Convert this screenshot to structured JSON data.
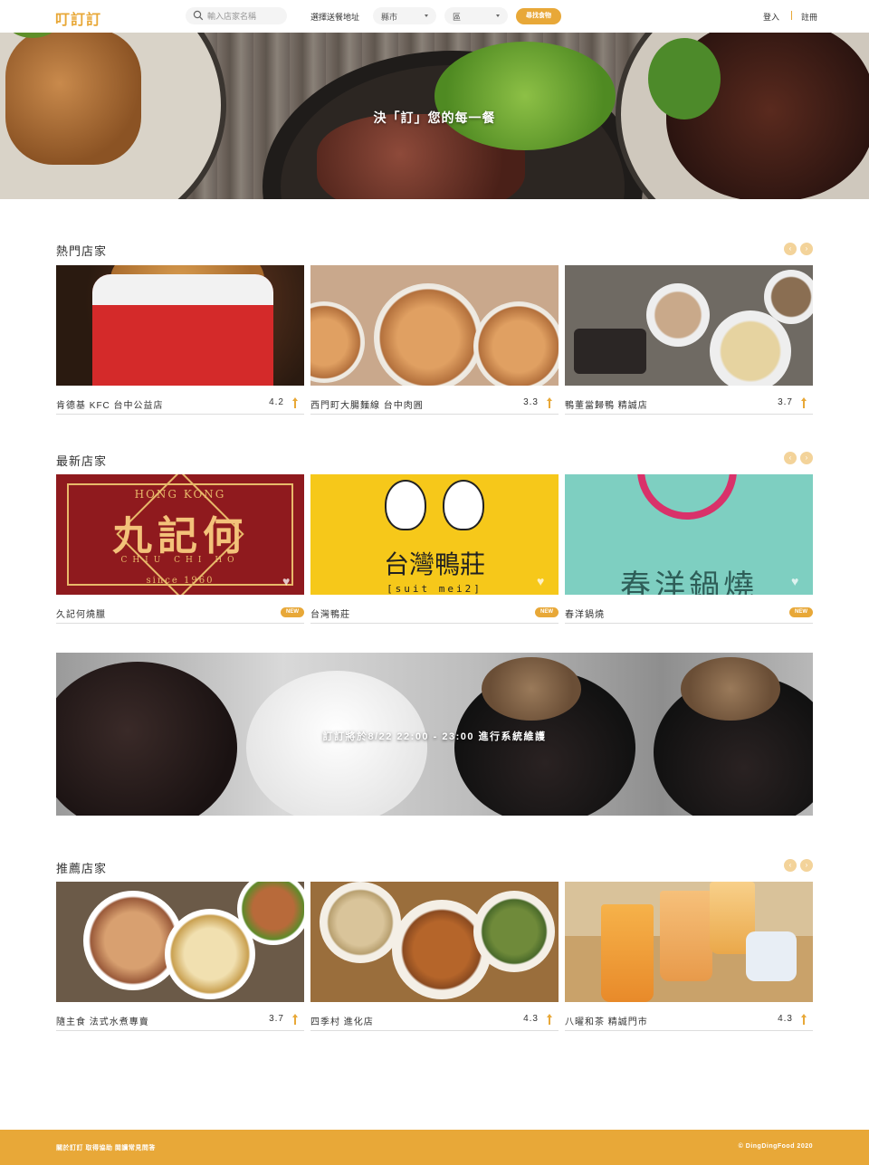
{
  "header": {
    "logo": "叮訂訂",
    "search_placeholder": "輸入店家名稱",
    "address_label": "選擇送餐地址",
    "city_select": "縣市",
    "district_select": "區",
    "find_button": "尋找食物",
    "login": "登入",
    "register": "註冊"
  },
  "hero": {
    "slogan": "決「訂」您的每一餐"
  },
  "sections": {
    "popular": {
      "title": "熱門店家",
      "items": [
        {
          "name": "肯德基 KFC 台中公益店",
          "rating": "4.2"
        },
        {
          "name": "西門町大腸麵線 台中肉圓",
          "rating": "3.3"
        },
        {
          "name": "鴨董當歸鴨 精誠店",
          "rating": "3.7"
        }
      ]
    },
    "newest": {
      "title": "最新店家",
      "badge": "NEW",
      "items": [
        {
          "name": "久記何燒臘",
          "logo_l1": "HONG KONG",
          "logo_l2": "九記何",
          "logo_l3": "CHIU  CHI  HO",
          "logo_l4": "since 1960"
        },
        {
          "name": "台灣鴨莊",
          "logo_l1": "台灣鴨莊",
          "logo_l2": "[suit mei2]"
        },
        {
          "name": "春洋鍋燒",
          "logo_l1": "春洋鍋燒"
        }
      ]
    },
    "banner": {
      "text": "訂訂將於8/22 22:00 - 23:00 進行系統維護"
    },
    "recommended": {
      "title": "推薦店家",
      "items": [
        {
          "name": "隨主食 法式水煮專賣",
          "rating": "3.7"
        },
        {
          "name": "四季村 進化店",
          "rating": "4.3"
        },
        {
          "name": "八曜和茶 精誠門市",
          "rating": "4.3"
        }
      ]
    }
  },
  "footer": {
    "links": "關於訂訂  取得協助  閱讀常見問答",
    "copyright": "© DingDingFood 2020"
  },
  "colors": {
    "accent": "#e8a838",
    "accent_light": "#f3d39a"
  },
  "icons": [
    "search-icon",
    "chevron-down-icon",
    "chevron-left-icon",
    "chevron-right-icon",
    "arrow-up-icon",
    "heart-icon"
  ]
}
